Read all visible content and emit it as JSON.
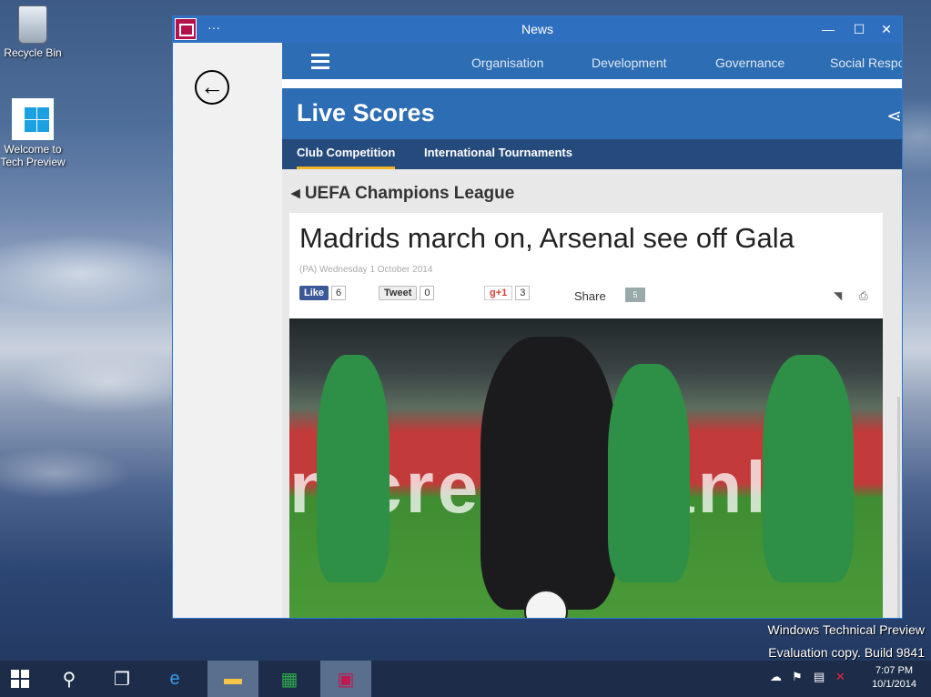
{
  "desktop": {
    "icons": [
      {
        "label": "Recycle Bin"
      },
      {
        "label": "Welcome to Tech Preview"
      }
    ],
    "watermark": {
      "line1": "Windows Technical Preview",
      "line2": "Evaluation copy. Build 9841"
    }
  },
  "window": {
    "title": "News",
    "more": "···",
    "min": "—",
    "max": "☐",
    "close": "✕"
  },
  "nav": {
    "links": [
      "Organisation",
      "Development",
      "Governance",
      "Social Respo"
    ]
  },
  "section": {
    "title": "Live Scores",
    "tabs": [
      "Club Competition",
      "International Tournaments"
    ],
    "active_tab": "Club Competition"
  },
  "article": {
    "league": "UEFA Champions League",
    "headline": "Madrids march on, Arsenal see off Gala",
    "byline": "(PA) Wednesday 1 October 2014",
    "social": {
      "fb_label": "Like",
      "fb_count": "6",
      "tw_label": "Tweet",
      "tw_count": "0",
      "gp_label": "g+1",
      "gp_count": "3",
      "share_label": "Share",
      "comments": "5"
    }
  },
  "taskbar": {
    "time": "7:07 PM",
    "date": "10/1/2014"
  },
  "colors": {
    "titlebar": "#2f6fc0",
    "nav": "#2d6db3",
    "subtabs": "#254a7c",
    "active_tab_underline": "#f0b429",
    "taskbar": "#1d2d49"
  }
}
